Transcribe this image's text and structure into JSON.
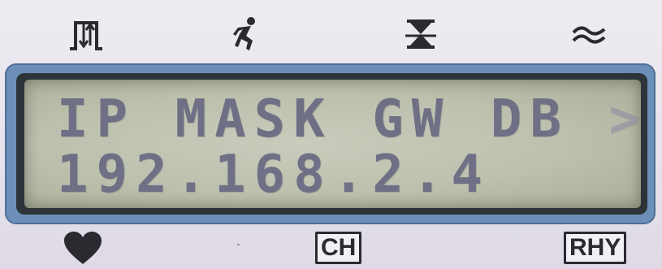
{
  "top_icons": [
    {
      "name": "stair-updown-icon"
    },
    {
      "name": "running-figure-icon"
    },
    {
      "name": "hourglass-icon"
    },
    {
      "name": "wave-icon"
    }
  ],
  "lcd": {
    "line1_main": "IP MASK GW DB ",
    "line1_more": ">>",
    "line2": "192.168.2.4"
  },
  "bottom_keys": {
    "heart_icon": "heart-icon",
    "ch_label": "CH",
    "rhy_label": "RHY"
  },
  "colors": {
    "lcd_text": "#6f6f86",
    "lcd_frame": "#6b8fb6",
    "lcd_background": "#bcc0ad",
    "body": "#e9e6ee",
    "ink": "#2b2a30"
  }
}
